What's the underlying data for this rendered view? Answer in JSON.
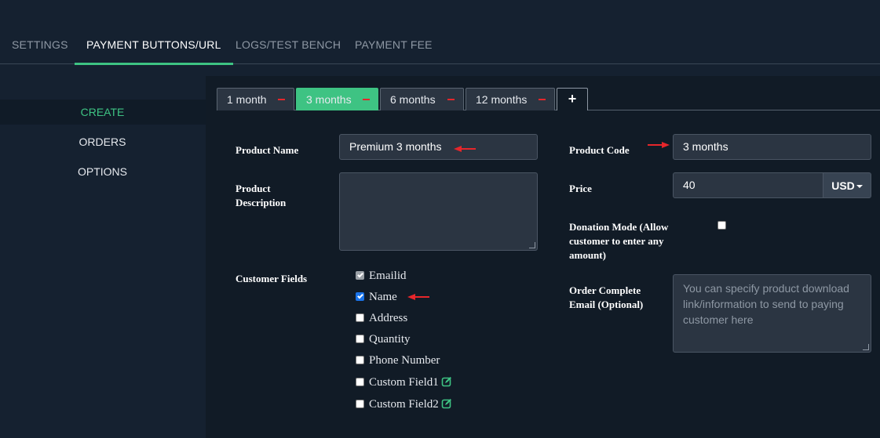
{
  "top_tabs": [
    {
      "label": "SETTINGS"
    },
    {
      "label": "PAYMENT BUTTONS/URL"
    },
    {
      "label": "LOGS/TEST BENCH"
    },
    {
      "label": "PAYMENT FEE"
    }
  ],
  "top_tab_active": "PAYMENT BUTTONS/URL",
  "left_nav": [
    {
      "label": "CREATE"
    },
    {
      "label": "ORDERS"
    },
    {
      "label": "OPTIONS"
    }
  ],
  "product_tabs": [
    {
      "label": "1 month"
    },
    {
      "label": "3 months"
    },
    {
      "label": "6 months"
    },
    {
      "label": "12 months"
    },
    {
      "label": "+"
    }
  ],
  "active_product_tab": "3 months",
  "form": {
    "product_name_label": "Product Name",
    "product_name_value": "Premium 3 months",
    "product_description_label": "Product Description",
    "product_description_value": "",
    "customer_fields_label": "Customer Fields",
    "customer_fields": [
      {
        "label": "Emailid",
        "checked": true,
        "disabled": true
      },
      {
        "label": "Name",
        "checked": true,
        "disabled": false
      },
      {
        "label": "Address",
        "checked": false,
        "disabled": false
      },
      {
        "label": "Quantity",
        "checked": false,
        "disabled": false
      },
      {
        "label": "Phone Number",
        "checked": false,
        "disabled": false
      },
      {
        "label": "Custom Field1",
        "checked": false,
        "disabled": false
      },
      {
        "label": "Custom Field2",
        "checked": false,
        "disabled": false
      }
    ],
    "product_code_label": "Product Code",
    "product_code_value": "3 months",
    "price_label": "Price",
    "price_value": "40",
    "currency": "USD",
    "donation_label": "Donation Mode (Allow customer to enter any amount)",
    "donation_checked": false,
    "order_email_label": "Order Complete Email (Optional)",
    "order_email_placeholder": "You can specify product download link/information to send to paying customer here"
  },
  "colors": {
    "accent": "#3ec383",
    "background": "#152130",
    "panel": "#111b26",
    "input": "#2b3542",
    "annotation_arrow": "#e6262b"
  },
  "icons": {
    "remove_tab": "minus-icon",
    "add_tab": "plus-icon",
    "edit": "edit-square-icon",
    "annotation": "red-arrow-icon"
  }
}
